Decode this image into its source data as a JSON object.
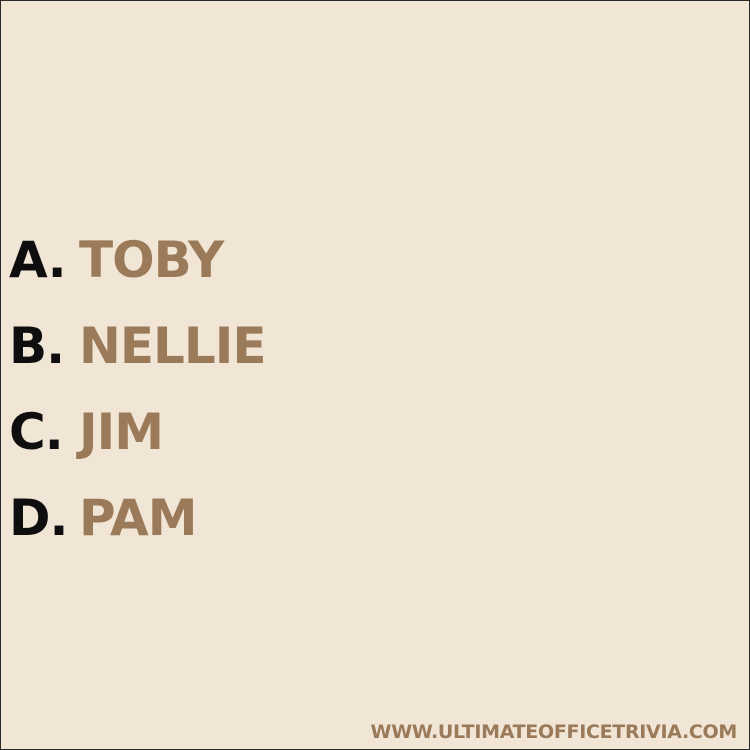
{
  "colors": {
    "background": "#f1e5d6",
    "letter": "#0e0e0e",
    "answer": "#9a7a58"
  },
  "options": [
    {
      "letter": "A.",
      "answer": "TOBY"
    },
    {
      "letter": "B.",
      "answer": "NELLIE"
    },
    {
      "letter": "C.",
      "answer": "JIM"
    },
    {
      "letter": "D.",
      "answer": "PAM"
    }
  ],
  "footer": {
    "url": "WWW.ULTIMATEOFFICETRIVIA.COM"
  }
}
